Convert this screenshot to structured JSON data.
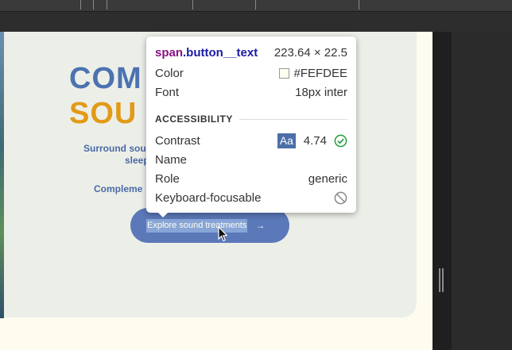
{
  "page": {
    "headline_line1": "COM",
    "headline_line2": "SOU",
    "subtext_line1": "Surround sou",
    "subtext_line2": "sleep",
    "subtext_line3": "Compleme",
    "cta_label": "Explore sound treatments",
    "cta_arrow": "→"
  },
  "inspector": {
    "element_tag": "span",
    "element_class": ".button__text",
    "dimensions": "223.64 × 22.5",
    "color_label": "Color",
    "color_value": "#FEFDEE",
    "font_label": "Font",
    "font_value": "18px inter",
    "section_title": "ACCESSIBILITY",
    "contrast_label": "Contrast",
    "contrast_badge": "Aa",
    "contrast_value": "4.74",
    "name_label": "Name",
    "name_value": "",
    "role_label": "Role",
    "role_value": "generic",
    "keyboard_label": "Keyboard-focusable"
  },
  "colors": {
    "headline_blue": "#4c72b0",
    "headline_orange": "#e29a17",
    "cta_bg": "#5b78b9",
    "text_color": "#FEFDEE",
    "check_green": "#1e9e3a"
  },
  "icons": [
    "check-circle-icon",
    "not-allowed-icon",
    "arrow-right-icon",
    "mouse-cursor-icon"
  ]
}
